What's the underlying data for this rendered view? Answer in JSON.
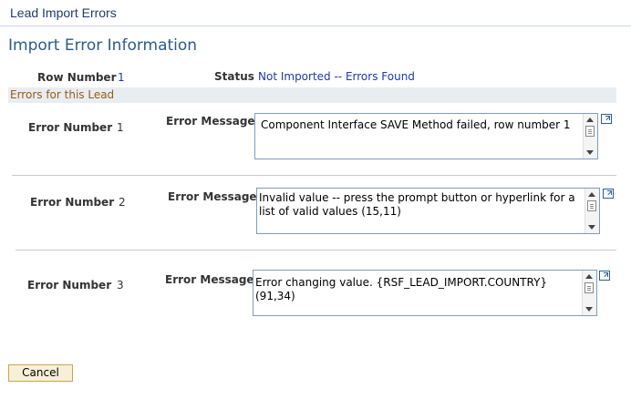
{
  "header": {
    "title": "Lead Import Errors"
  },
  "section": {
    "title": "Import Error Information"
  },
  "summary": {
    "row_number_label": "Row Number",
    "row_number_value": "1",
    "status_label": "Status",
    "status_value": "Not Imported -- Errors Found"
  },
  "errors_group": {
    "title": "Errors for this Lead"
  },
  "errors": [
    {
      "number_label": "Error Number",
      "number": "1",
      "message_label": "Error Message",
      "message": "Component Interface SAVE Method failed, row number 1"
    },
    {
      "number_label": "Error Number",
      "number": "2",
      "message_label": "Error Message",
      "message": "Invalid value -- press the prompt button or hyperlink for a list of valid values (15,11)"
    },
    {
      "number_label": "Error Number",
      "number": "3",
      "message_label": "Error Message",
      "message": "Error changing value. {RSF_LEAD_IMPORT.COUNTRY} (91,34)"
    }
  ],
  "footer": {
    "cancel_label": "Cancel"
  }
}
